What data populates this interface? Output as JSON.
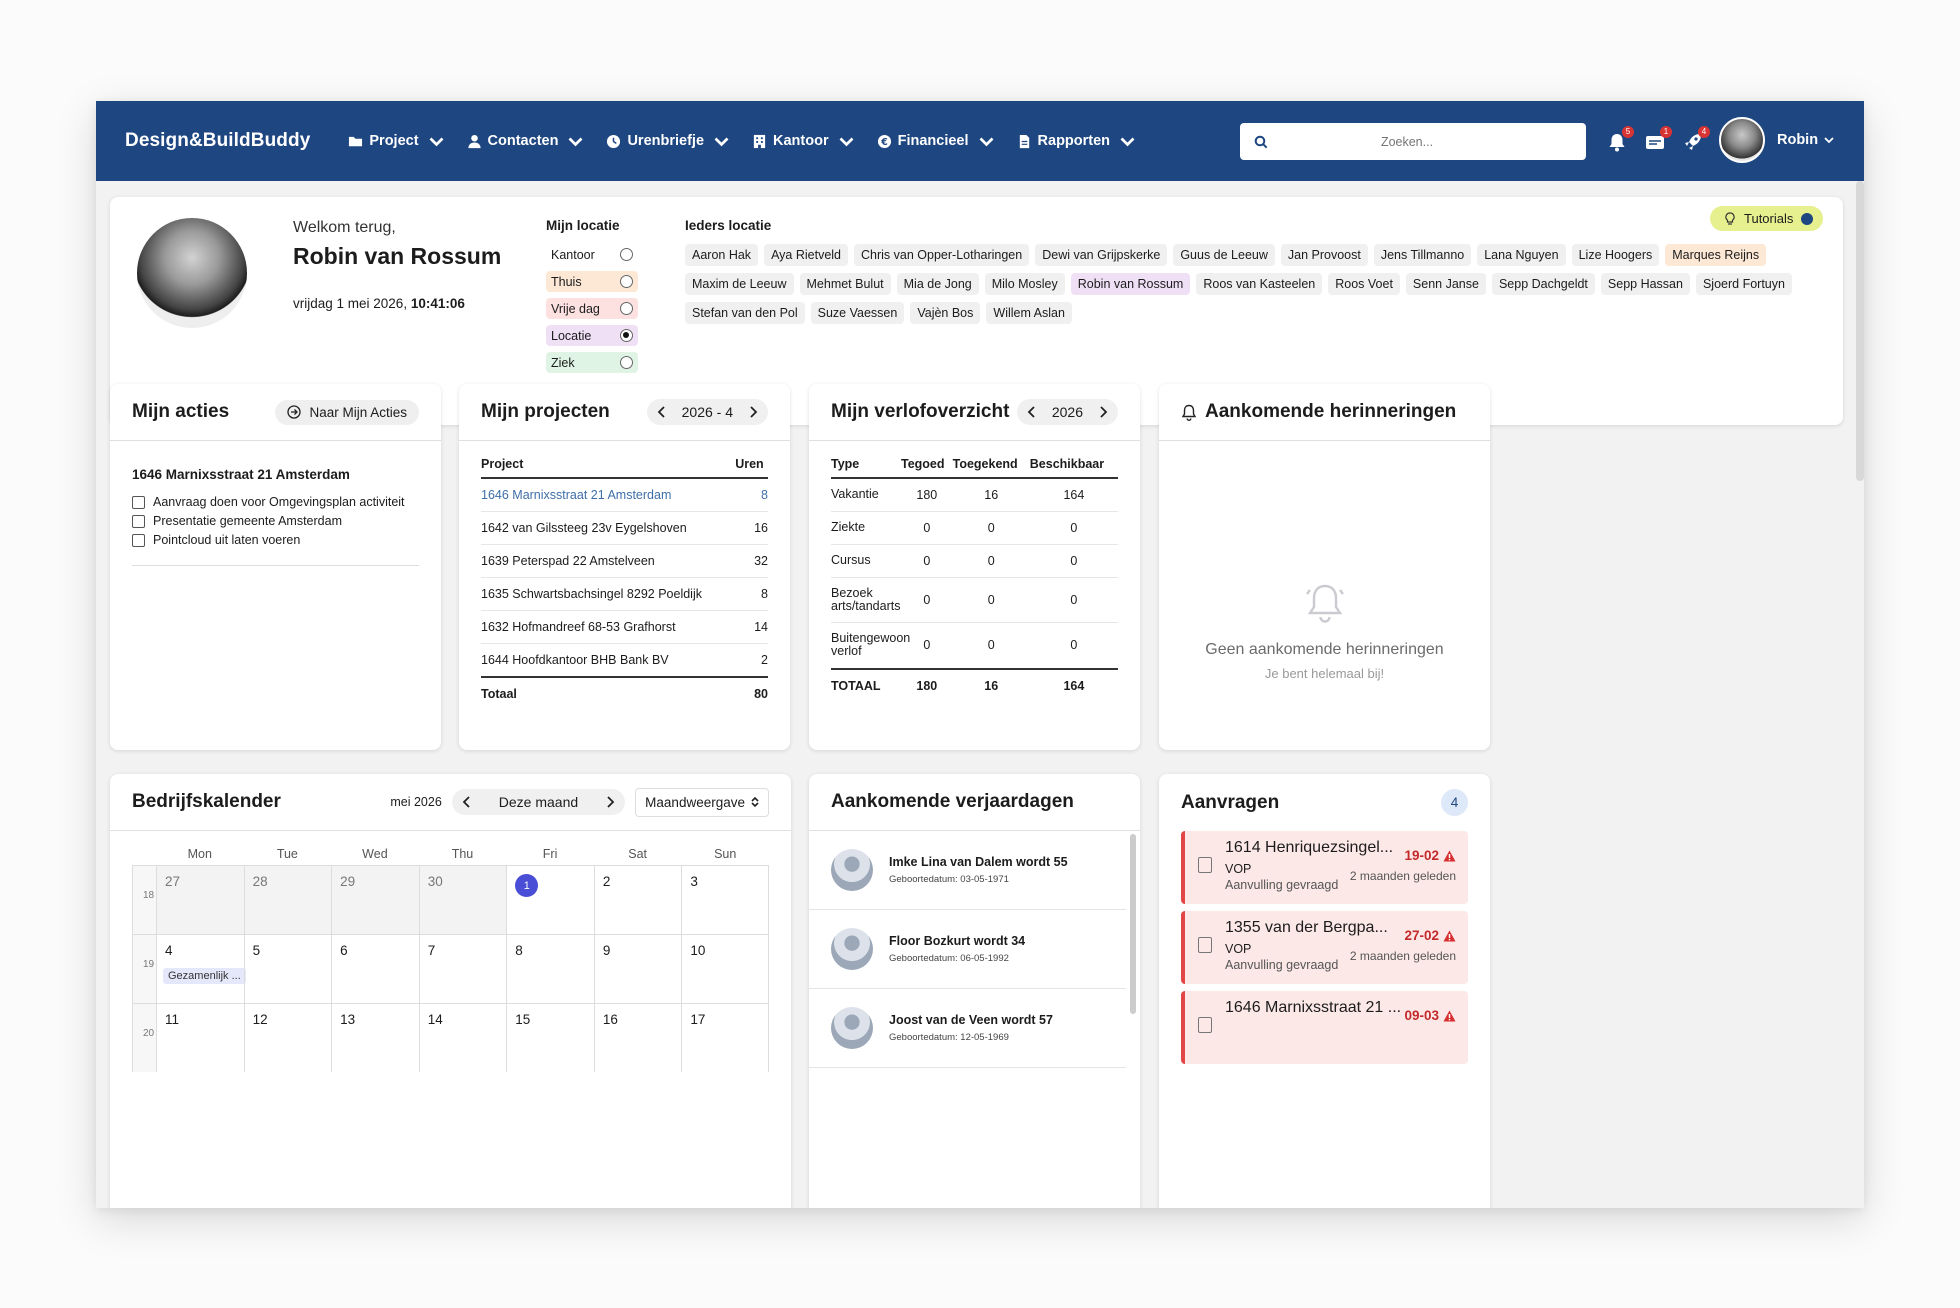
{
  "nav": {
    "brand": "Design&BuildBuddy",
    "menu": [
      "Project",
      "Contacten",
      "Urenbriefje",
      "Kantoor",
      "Financieel",
      "Rapporten"
    ],
    "search_placeholder": "Zoeken...",
    "badges": {
      "notifications": "5",
      "messages": "1",
      "updates": "4"
    },
    "user": "Robin"
  },
  "welcome": {
    "greeting": "Welkom terug,",
    "name": "Robin van Rossum",
    "date": "vrijdag 1 mei 2026, ",
    "time": "10:41:06",
    "my_location_title": "Mijn locatie",
    "locations": [
      {
        "label": "Kantoor",
        "color": "#ffffff",
        "selected": false
      },
      {
        "label": "Thuis",
        "color": "#fde8d6",
        "selected": false
      },
      {
        "label": "Vrije dag",
        "color": "#fde1e1",
        "selected": false
      },
      {
        "label": "Locatie",
        "color": "#efe0f6",
        "selected": true
      },
      {
        "label": "Ziek",
        "color": "#dff4e5",
        "selected": false
      }
    ],
    "team_title": "Ieders locatie",
    "team": [
      {
        "name": "Aaron Hak",
        "color": "#f0f0f0"
      },
      {
        "name": "Aya Rietveld",
        "color": "#f0f0f0"
      },
      {
        "name": "Chris van Opper-Lotharingen",
        "color": "#f0f0f0"
      },
      {
        "name": "Dewi van Grijpskerke",
        "color": "#f0f0f0"
      },
      {
        "name": "Guus de Leeuw",
        "color": "#f0f0f0"
      },
      {
        "name": "Jan Provoost",
        "color": "#f0f0f0"
      },
      {
        "name": "Jens Tillmanno",
        "color": "#f0f0f0"
      },
      {
        "name": "Lana Nguyen",
        "color": "#f0f0f0"
      },
      {
        "name": "Lize Hoogers",
        "color": "#f0f0f0"
      },
      {
        "name": "Marques Reijns",
        "color": "#fde8d6"
      },
      {
        "name": "Maxim de Leeuw",
        "color": "#f0f0f0"
      },
      {
        "name": "Mehmet Bulut",
        "color": "#f0f0f0"
      },
      {
        "name": "Mia de Jong",
        "color": "#f0f0f0"
      },
      {
        "name": "Milo Mosley",
        "color": "#f0f0f0"
      },
      {
        "name": "Robin van Rossum",
        "color": "#efe0f6"
      },
      {
        "name": "Roos van Kasteelen",
        "color": "#f0f0f0"
      },
      {
        "name": "Roos Voet",
        "color": "#f0f0f0"
      },
      {
        "name": "Senn Janse",
        "color": "#f0f0f0"
      },
      {
        "name": "Sepp Dachgeldt",
        "color": "#f0f0f0"
      },
      {
        "name": "Sepp Hassan",
        "color": "#f0f0f0"
      },
      {
        "name": "Sjoerd Fortuyn",
        "color": "#f0f0f0"
      },
      {
        "name": "Stefan van den Pol",
        "color": "#f0f0f0"
      },
      {
        "name": "Suze Vaessen",
        "color": "#f0f0f0"
      },
      {
        "name": "Vajèn Bos",
        "color": "#f0f0f0"
      },
      {
        "name": "Willem Aslan",
        "color": "#f0f0f0"
      }
    ],
    "tutorials": "Tutorials"
  },
  "acties": {
    "title": "Mijn acties",
    "button": "Naar Mijn Acties",
    "project": "1646 Marnixsstraat 21 Amsterdam",
    "items": [
      "Aanvraag doen voor Omgevingsplan activiteit",
      "Presentatie gemeente Amsterdam",
      "Pointcloud uit laten voeren"
    ]
  },
  "projecten": {
    "title": "Mijn projecten",
    "period": "2026 - 4",
    "col_project": "Project",
    "col_uren": "Uren",
    "rows": [
      {
        "p": "1646 Marnixsstraat 21 Amsterdam",
        "u": "8"
      },
      {
        "p": "1642 van Gilssteeg 23v Eygelshoven",
        "u": "16"
      },
      {
        "p": "1639 Peterspad 22 Amstelveen",
        "u": "32"
      },
      {
        "p": "1635 Schwartsbachsingel 8292 Poeldijk",
        "u": "8"
      },
      {
        "p": "1632 Hofmandreef 68-53 Grafhorst",
        "u": "14"
      },
      {
        "p": "1644 Hoofdkantoor BHB Bank BV",
        "u": "2"
      }
    ],
    "total_label": "Totaal",
    "total": "80"
  },
  "verlof": {
    "title": "Mijn verlofoverzicht",
    "year": "2026",
    "cols": [
      "Type",
      "Tegoed",
      "Toegekend",
      "Beschikbaar"
    ],
    "rows": [
      [
        "Vakantie",
        "180",
        "16",
        "164"
      ],
      [
        "Ziekte",
        "0",
        "0",
        "0"
      ],
      [
        "Cursus",
        "0",
        "0",
        "0"
      ],
      [
        "Bezoek arts/tandarts",
        "0",
        "0",
        "0"
      ],
      [
        "Buitengewoon verlof",
        "0",
        "0",
        "0"
      ]
    ],
    "total": [
      "TOTAAL",
      "180",
      "16",
      "164"
    ]
  },
  "herinneringen": {
    "title": "Aankomende herinneringen",
    "empty": "Geen aankomende herinneringen",
    "sub": "Je bent helemaal bij!"
  },
  "kalender": {
    "title": "Bedrijfskalender",
    "month": "mei 2026",
    "current": "Deze maand",
    "view": "Maandweergave",
    "days": [
      "Mon",
      "Tue",
      "Wed",
      "Thu",
      "Fri",
      "Sat",
      "Sun"
    ],
    "weeks": [
      {
        "wk": "18",
        "d": [
          "27",
          "28",
          "29",
          "30",
          "1",
          "2",
          "3"
        ]
      },
      {
        "wk": "19",
        "d": [
          "4",
          "5",
          "6",
          "7",
          "8",
          "9",
          "10"
        ]
      },
      {
        "wk": "20",
        "d": [
          "11",
          "12",
          "13",
          "14",
          "15",
          "16",
          "17"
        ]
      }
    ],
    "event": "Gezamenlijk ..."
  },
  "verjaardagen": {
    "title": "Aankomende verjaardagen",
    "items": [
      {
        "n": "Imke Lina van Dalem wordt 55",
        "d": "Geboortedatum: 03-05-1971"
      },
      {
        "n": "Floor Bozkurt wordt 34",
        "d": "Geboortedatum: 06-05-1992"
      },
      {
        "n": "Joost van de Veen wordt 57",
        "d": "Geboortedatum: 12-05-1969"
      }
    ]
  },
  "aanvragen": {
    "title": "Aanvragen",
    "count": "4",
    "items": [
      {
        "t": "1614 Henriquezsingel...",
        "v": "VOP",
        "a": "Aanvulling gevraagd",
        "dt": "19-02",
        "ago": "2 maanden geleden"
      },
      {
        "t": "1355 van der Bergpa...",
        "v": "VOP",
        "a": "Aanvulling gevraagd",
        "dt": "27-02",
        "ago": "2 maanden geleden"
      },
      {
        "t": "1646 Marnixsstraat 21 ...",
        "v": "",
        "a": "",
        "dt": "09-03",
        "ago": ""
      }
    ]
  }
}
